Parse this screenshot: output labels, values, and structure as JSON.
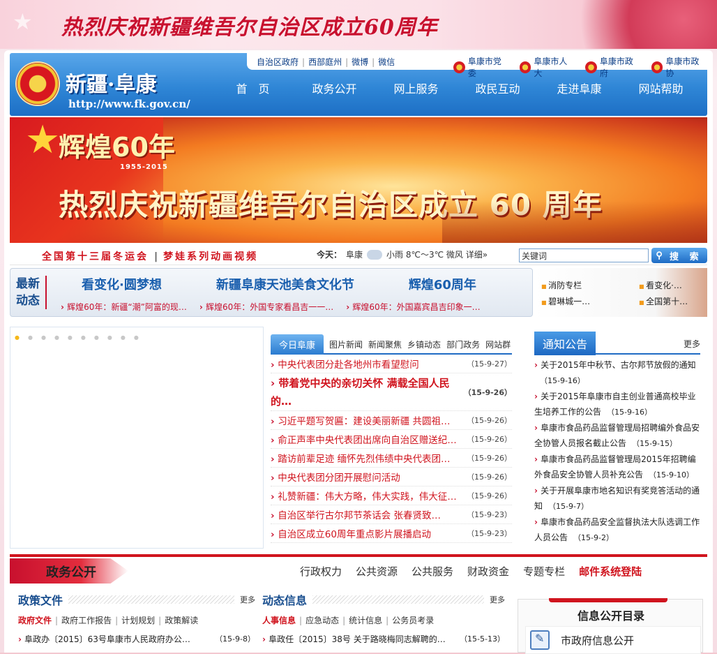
{
  "top_banner": {
    "slogan": "热烈庆祝新疆维吾尔自治区成立60周年"
  },
  "header": {
    "site_title": "新疆·阜康",
    "site_url": "http://www.fk.gov.cn/",
    "top_links": [
      "自治区政府",
      "西部庭州",
      "微博",
      "微信"
    ],
    "gov_links": [
      "阜康市党委",
      "阜康市人大",
      "阜康市政府",
      "阜康市政协"
    ],
    "nav": [
      "首　页",
      "政务公开",
      "网上服务",
      "政民互动",
      "走进阜康",
      "网站帮助"
    ]
  },
  "hero": {
    "huihuang": "辉煌60年",
    "years": "1955-2015",
    "headline": "热烈庆祝新疆维吾尔自治区成立 60 周年"
  },
  "ticker": {
    "link1": "全国第十三届冬运会",
    "link2": "梦娃系列动画视频",
    "weather_label": "今天：",
    "weather_city": "阜康",
    "weather_text": "小雨  8℃～3℃  微风  详细»",
    "search_placeholder": "关键词",
    "search_value": "关键词",
    "search_button": "搜 索"
  },
  "latest": {
    "label": "最新动态",
    "topics": [
      "看变化·圆梦想",
      "新疆阜康天池美食文化节",
      "辉煌60周年"
    ],
    "heads": [
      "辉煌60年：新疆“潮”阿富的现…",
      "辉煌60年：外国专家看昌吉一一…",
      "辉煌60年：外国嘉宾昌吉印象一…"
    ]
  },
  "side_links": [
    "消防专栏",
    "看变化·…",
    "碧琳城一…",
    "全国第十…"
  ],
  "news": {
    "tabs": [
      "今日阜康",
      "图片新闻",
      "新闻聚焦",
      "乡镇动态",
      "部门政务",
      "网站群"
    ],
    "items": [
      {
        "title": "中央代表团分赴各地州市看望慰问",
        "date": "（15-9-27）"
      },
      {
        "title": "带着党中央的亲切关怀 满载全国人民的…",
        "date": "（15-9-26）"
      },
      {
        "title": "习近平题写贺匾：建设美丽新疆 共圆祖…",
        "date": "（15-9-26）"
      },
      {
        "title": "俞正声率中央代表团出席向自治区赠送纪…",
        "date": "（15-9-26）"
      },
      {
        "title": "踏访前辈足迹 缅怀先烈伟绩中央代表团…",
        "date": "（15-9-26）"
      },
      {
        "title": "中央代表团分团开展慰问活动",
        "date": "（15-9-26）"
      },
      {
        "title": "礼赞新疆：伟大方略，伟大实践，伟大征…",
        "date": "（15-9-26）"
      },
      {
        "title": "自治区举行古尔邦节茶话会 张春贤致…",
        "date": "（15-9-23）"
      },
      {
        "title": "自治区成立60周年重点影片展播启动",
        "date": "（15-9-23）"
      }
    ]
  },
  "notice": {
    "title": "通知公告",
    "more": "更多",
    "items": [
      {
        "title": "关于2015年中秋节、古尔邦节放假的通知",
        "date": "（15-9-16）"
      },
      {
        "title": "关于2015年阜康市自主创业普通高校毕业生培养工作的公告",
        "date": "（15-9-16）"
      },
      {
        "title": "阜康市食品药品监督管理局招聘编外食品安全协管人员报名截止公告",
        "date": "（15-9-15）"
      },
      {
        "title": "阜康市食品药品监督管理局2015年招聘编外食品安全协管人员补充公告",
        "date": "（15-9-10）"
      },
      {
        "title": "关于开展阜康市地名知识有奖竞答活动的通知",
        "date": "（15-9-7）"
      },
      {
        "title": "阜康市食品药品安全监督执法大队选调工作人员公告",
        "date": "（15-9-2）"
      }
    ]
  },
  "zwgk": {
    "title": "政务公开",
    "nav": [
      "行政权力",
      "公共资源",
      "公共服务",
      "财政资金",
      "专题专栏"
    ],
    "mail": "邮件系统登陆"
  },
  "policy": {
    "title": "政策文件",
    "more": "更多",
    "tabs": [
      "政府文件",
      "政府工作报告",
      "计划规划",
      "政策解读"
    ],
    "item": {
      "title": "阜政办〔2015〕63号阜康市人民政府办公…",
      "date": "（15-9-8）"
    }
  },
  "dynamic": {
    "title": "动态信息",
    "more": "更多",
    "tabs": [
      "人事信息",
      "应急动态",
      "统计信息",
      "公务员考录"
    ],
    "item": {
      "title": "阜政任〔2015〕38号 关于路晓梅同志解聘的…",
      "date": "（15-5-13）"
    }
  },
  "info_catalog": {
    "title": "信息公开目录",
    "row": "市政府信息公开"
  }
}
